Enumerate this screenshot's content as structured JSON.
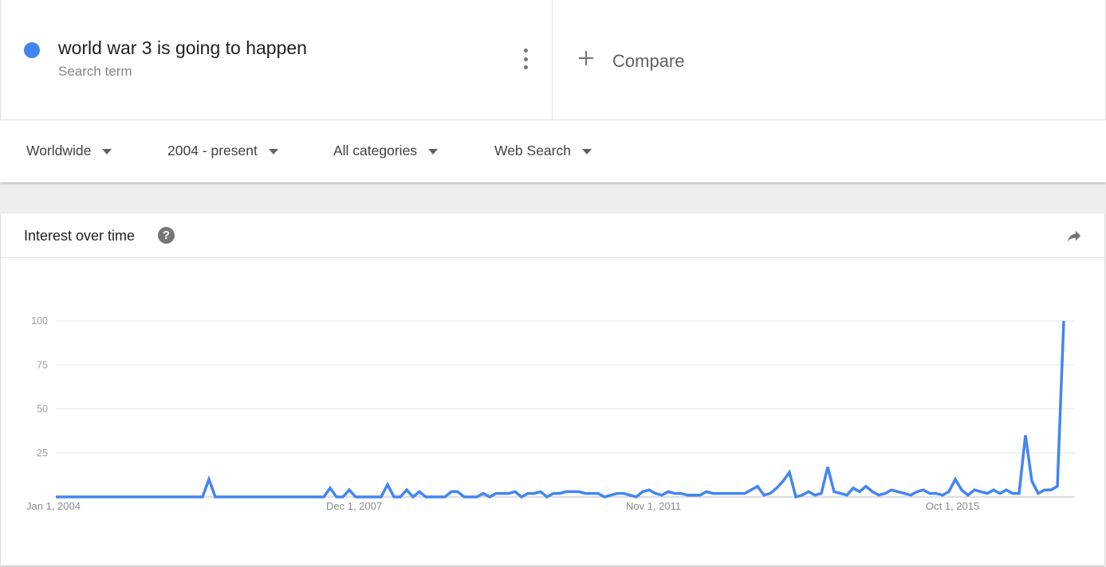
{
  "search_term": {
    "name": "world war 3 is going to happen",
    "subtitle": "Search term",
    "color": "#4285f4",
    "menu_icon": "more-vert-icon"
  },
  "compare": {
    "label": "Compare",
    "icon": "plus-icon"
  },
  "filters": [
    {
      "label": "Worldwide"
    },
    {
      "label": "2004 - present"
    },
    {
      "label": "All categories"
    },
    {
      "label": "Web Search"
    }
  ],
  "card": {
    "title": "Interest over time",
    "help_icon": "?",
    "share_icon": "share-icon"
  },
  "chart_data": {
    "type": "line",
    "title": "Interest over time",
    "xlabel": "",
    "ylabel": "",
    "ylim": [
      0,
      100
    ],
    "grid": true,
    "legend": "none",
    "line_color": "#4285f4",
    "y_ticks": [
      25,
      50,
      75,
      100
    ],
    "x_tick_labels": [
      {
        "label": "Jan 1, 2004",
        "index": 0
      },
      {
        "label": "Dec 1, 2007",
        "index": 47
      },
      {
        "label": "Nov 1, 2011",
        "index": 94
      },
      {
        "label": "Oct 1, 2015",
        "index": 141
      }
    ],
    "x_start": "Jan 2004",
    "x_interval": "monthly",
    "series": [
      {
        "name": "world war 3 is going to happen",
        "values": [
          0,
          0,
          0,
          0,
          0,
          0,
          0,
          0,
          0,
          0,
          0,
          0,
          0,
          0,
          0,
          0,
          0,
          0,
          0,
          0,
          0,
          0,
          0,
          0,
          10,
          0,
          0,
          0,
          0,
          0,
          0,
          0,
          0,
          0,
          0,
          0,
          0,
          0,
          0,
          0,
          0,
          0,
          0,
          5,
          0,
          0,
          4,
          0,
          0,
          0,
          0,
          0,
          7,
          0,
          0,
          4,
          0,
          3,
          0,
          0,
          0,
          0,
          3,
          3,
          0,
          0,
          0,
          2,
          0,
          2,
          2,
          2,
          3,
          0,
          2,
          2,
          3,
          0,
          2,
          2,
          3,
          3,
          3,
          2,
          2,
          2,
          0,
          1,
          2,
          2,
          1,
          0,
          3,
          4,
          2,
          1,
          3,
          2,
          2,
          1,
          1,
          1,
          3,
          2,
          2,
          2,
          2,
          2,
          2,
          4,
          6,
          1,
          2,
          5,
          9,
          14,
          0,
          1,
          3,
          1,
          2,
          17,
          3,
          2,
          1,
          5,
          3,
          6,
          3,
          1,
          2,
          4,
          3,
          2,
          1,
          3,
          4,
          2,
          2,
          1,
          3,
          10,
          4,
          1,
          4,
          3,
          2,
          4,
          2,
          4,
          2,
          2,
          35,
          9,
          2,
          4,
          4,
          6,
          100
        ]
      }
    ]
  }
}
